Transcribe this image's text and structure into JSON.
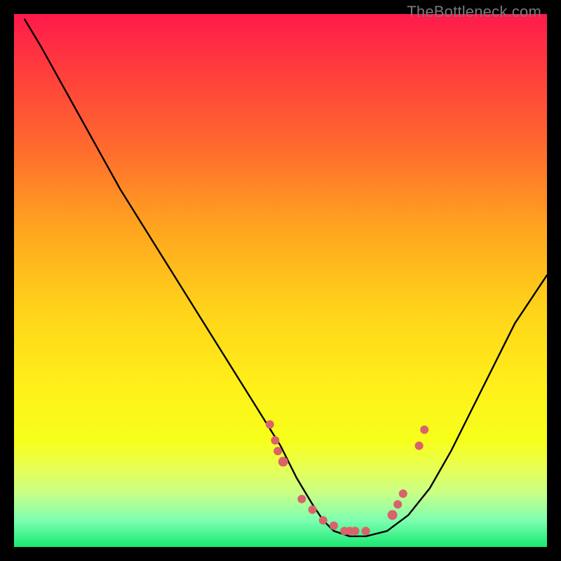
{
  "watermark": "TheBottleneck.com",
  "chart_data": {
    "type": "line",
    "title": "",
    "xlabel": "",
    "ylabel": "",
    "xlim": [
      0,
      100
    ],
    "ylim": [
      0,
      100
    ],
    "curve": {
      "name": "bottleneck-curve",
      "x": [
        2,
        5,
        10,
        15,
        20,
        25,
        30,
        35,
        40,
        45,
        50,
        53,
        56,
        58,
        60,
        63,
        66,
        70,
        74,
        78,
        82,
        86,
        90,
        94,
        98,
        100
      ],
      "y": [
        99,
        94,
        85,
        76,
        67,
        59,
        51,
        43,
        35,
        27,
        19,
        13,
        8,
        5,
        3,
        2,
        2,
        3,
        6,
        11,
        18,
        26,
        34,
        42,
        48,
        51
      ]
    },
    "highlight_points": {
      "name": "highlight-dots",
      "x": [
        48,
        49,
        49.5,
        50.5,
        54,
        56,
        58,
        60,
        62,
        63,
        64,
        66,
        71,
        72,
        73,
        76,
        77
      ],
      "y": [
        23,
        20,
        18,
        16,
        9,
        7,
        5,
        4,
        3,
        3,
        3,
        3,
        6,
        8,
        10,
        19,
        22
      ]
    },
    "gradient_stops": [
      {
        "pos": 0,
        "color": "#ff1a4b"
      },
      {
        "pos": 25,
        "color": "#ff6a2e"
      },
      {
        "pos": 55,
        "color": "#ffd21a"
      },
      {
        "pos": 85,
        "color": "#e9ff52"
      },
      {
        "pos": 100,
        "color": "#19e872"
      }
    ]
  }
}
